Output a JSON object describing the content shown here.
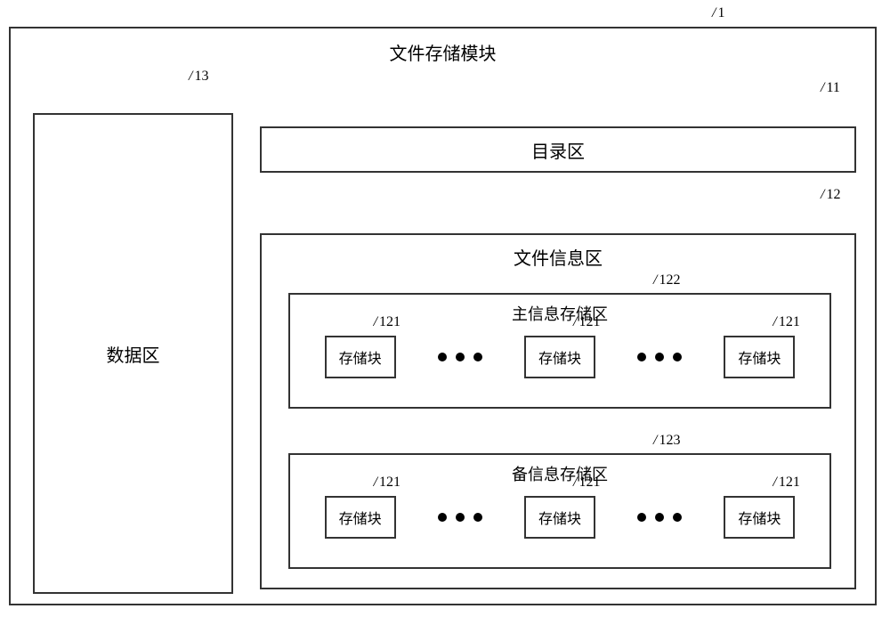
{
  "refs": {
    "outer": "1",
    "data_area": "13",
    "directory": "11",
    "file_info": "12",
    "main_storage": "122",
    "backup_storage": "123",
    "block": "121"
  },
  "labels": {
    "outer_title": "文件存储模块",
    "data_area": "数据区",
    "directory": "目录区",
    "file_info": "文件信息区",
    "main_storage": "主信息存储区",
    "backup_storage": "备信息存储区",
    "block": "存储块"
  }
}
